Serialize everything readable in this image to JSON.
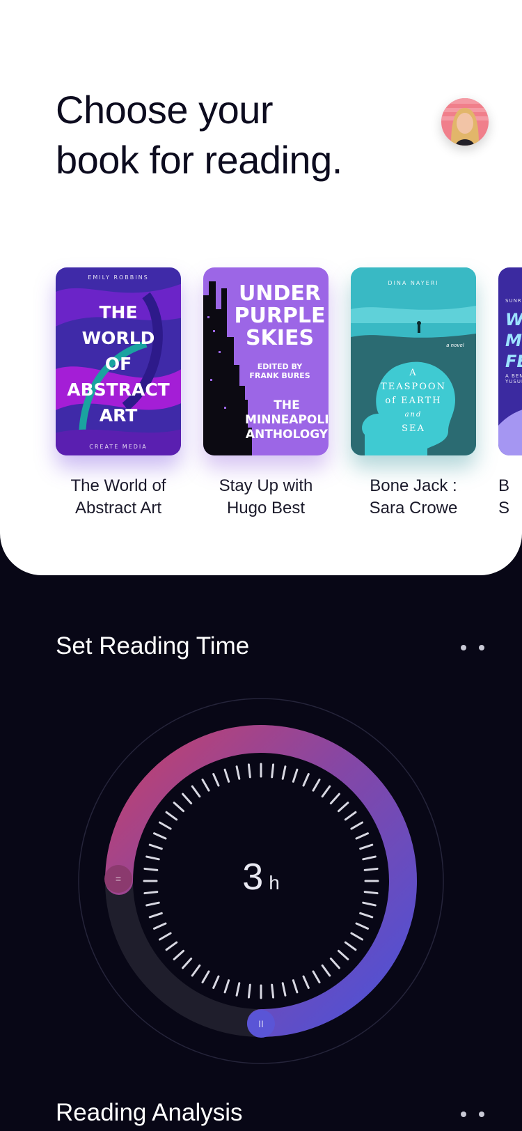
{
  "header": {
    "title_line1": "Choose your",
    "title_line2": "book for reading."
  },
  "books": [
    {
      "title_line1": "The World of",
      "title_line2": "Abstract Art",
      "cover": {
        "author": "EMILY ROBBINS",
        "lines": [
          "THE",
          "WORLD",
          "OF",
          "ABSTRACT",
          "ART"
        ],
        "publisher": "CREATE MEDIA"
      }
    },
    {
      "title_line1": "Stay Up with",
      "title_line2": "Hugo Best",
      "cover": {
        "lines": [
          "UNDER",
          "PURPLE",
          "SKIES"
        ],
        "edited": "EDITED BY",
        "editor": "FRANK BURES",
        "sub_lines": [
          "THE",
          "MINNEAPOLIS",
          "ANTHOLOGY"
        ]
      }
    },
    {
      "title_line1": "Bone Jack :",
      "title_line2": "Sara Crowe",
      "cover": {
        "author": "DINA NAYERI",
        "tag": "a novel",
        "lines": [
          "A",
          "TEASPOON",
          "of EARTH",
          "and",
          "SEA"
        ]
      }
    },
    {
      "title_line1": "B",
      "title_line2": "S",
      "cover": {
        "top": "SUNRISE",
        "lines": [
          "WA",
          "MU",
          "FE"
        ],
        "sub": "A BENEF",
        "sub2": "YUSUNG"
      }
    }
  ],
  "reading_time": {
    "section_title": "Set Reading Time",
    "value": "3",
    "unit": "h",
    "start_handle_icon": "=",
    "end_handle_icon": "II",
    "colors": {
      "arc_start": "#c2416e",
      "arc_mid": "#8447a6",
      "arc_end": "#4b52d9",
      "track": "#1f1e2c"
    }
  },
  "analysis": {
    "section_title": "Reading Analysis"
  }
}
